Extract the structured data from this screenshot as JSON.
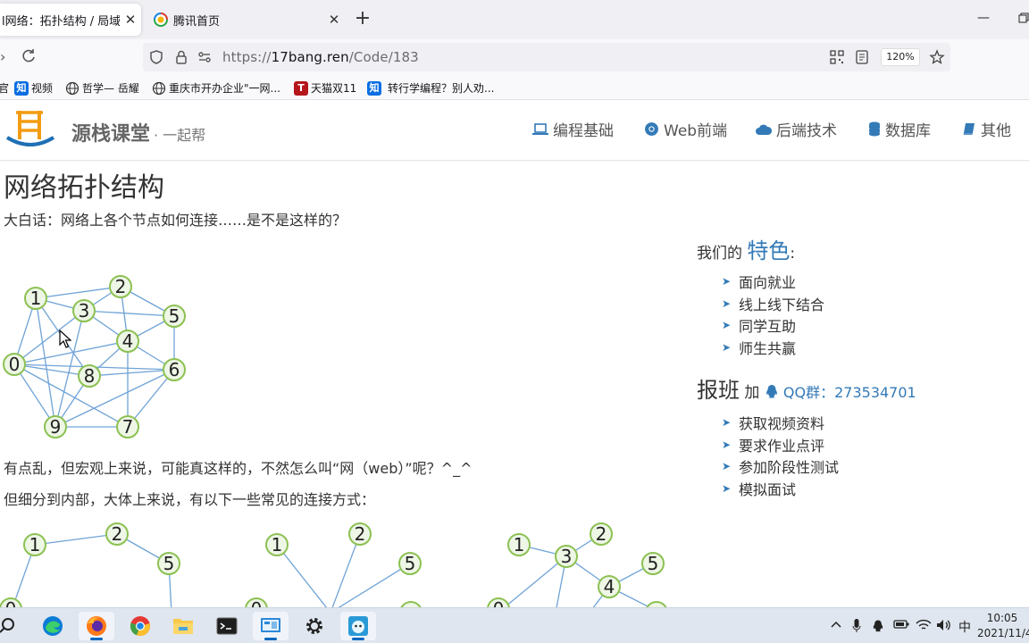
{
  "browser": {
    "tabs": [
      {
        "title": "l网络：拓扑结构 / 局域E",
        "active": true
      },
      {
        "title": "腾讯首页",
        "active": false
      }
    ],
    "url_prefix": "https://",
    "url_domain": "17bang.ren",
    "url_path": "/Code/183",
    "zoom": "120%",
    "bookmarks": [
      {
        "label": "官",
        "icon": "cut-bookmark-icon"
      },
      {
        "label": "视频",
        "icon": "zhihu-icon"
      },
      {
        "label": "哲学— 岳耀",
        "icon": "globe-icon"
      },
      {
        "label": "重庆市开办企业\"一网...",
        "icon": "globe-icon"
      },
      {
        "label": "天猫双11",
        "icon": "tmall-icon"
      },
      {
        "label": "转行学编程？别人劝...",
        "icon": "zhihu-icon"
      }
    ]
  },
  "site": {
    "brand": "源栈课堂",
    "tagline": "· 一起帮",
    "menu": [
      {
        "label": "编程基础",
        "icon": "laptop-icon"
      },
      {
        "label": "Web前端",
        "icon": "chrome-icon"
      },
      {
        "label": "后端技术",
        "icon": "cloud-icon"
      },
      {
        "label": "数据库",
        "icon": "database-icon"
      },
      {
        "label": "其他",
        "icon": "book-icon"
      }
    ]
  },
  "article": {
    "title": "网络拓扑结构",
    "intro": "大白话：网络上各个节点如何连接……是不是这样的？",
    "p2": "有点乱，但宏观上来说，可能真这样的，不然怎么叫“网（web）”呢？^_^",
    "p3": "但细分到内部，大体上来说，有以下一些常见的连接方式："
  },
  "sidebar": {
    "features_prefix": "我们的",
    "features_accent": "特色",
    "features_suffix": ":",
    "features": [
      "面向就业",
      "线上线下结合",
      "同学互助",
      "师生共赢"
    ],
    "signup_big": "报班",
    "signup_add": "加",
    "qq_label": "QQ群：273534701",
    "benefits": [
      "获取视频资料",
      "要求作业点评",
      "参加阶段性测试",
      "模拟面试"
    ]
  },
  "taskbar": {
    "apps": [
      "search-icon",
      "edge-icon",
      "firefox-icon",
      "chrome-icon",
      "file-explorer-icon",
      "terminal-icon",
      "control-panel-icon",
      "settings-icon",
      "ime-app-icon"
    ],
    "ime": "中",
    "time": "10:05",
    "date": "2021/11/4"
  },
  "colors": {
    "accent": "#337ab7",
    "node_fill": "#eef6e6",
    "node_stroke": "#8cc152",
    "edge": "#6fa3d6"
  }
}
